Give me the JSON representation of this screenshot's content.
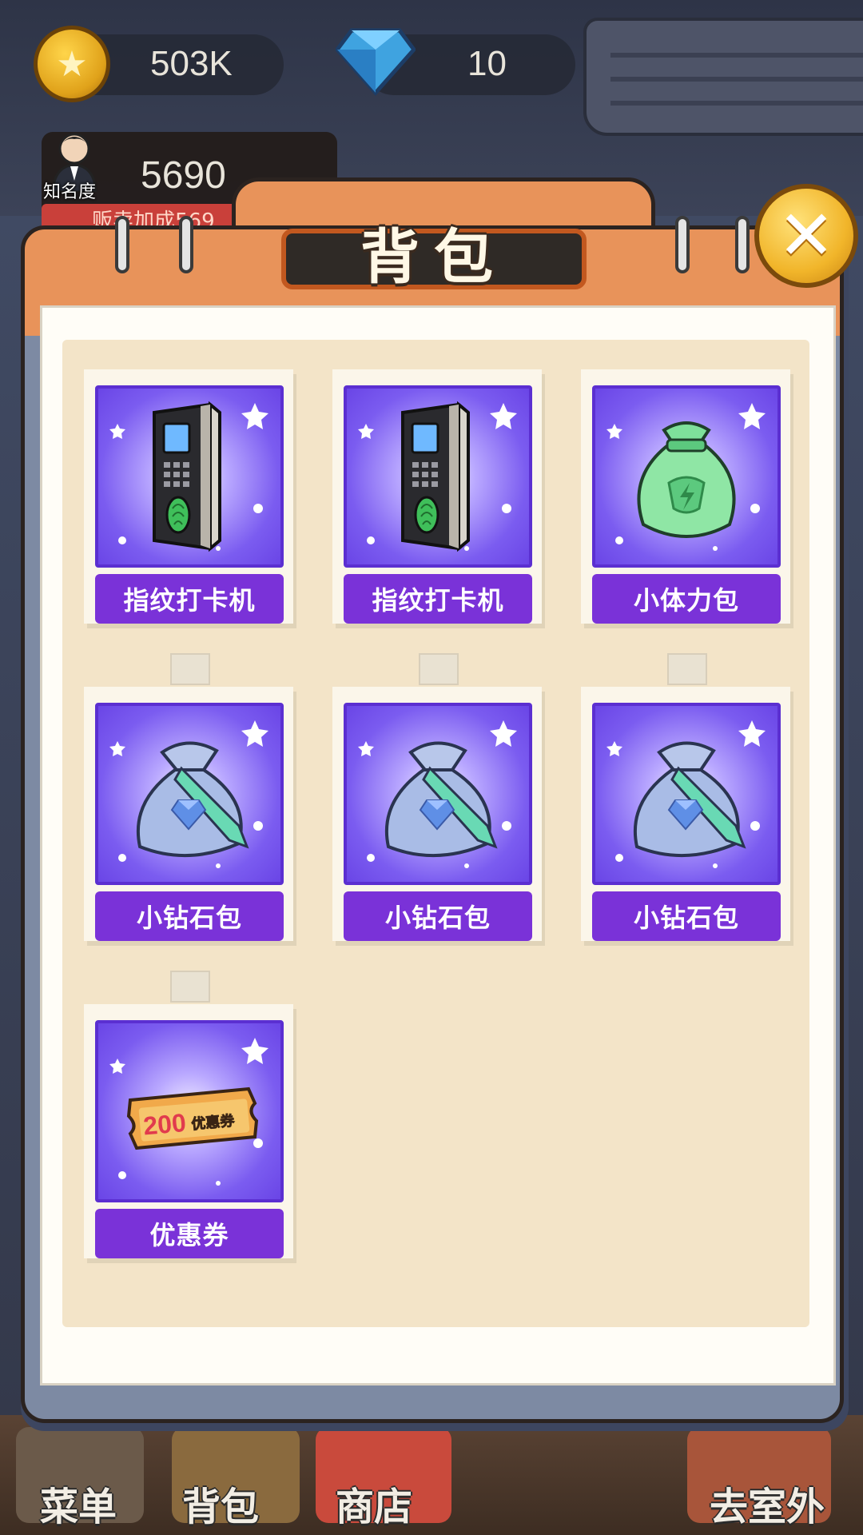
{
  "resources": {
    "coins": "503K",
    "gems": "10"
  },
  "fame": {
    "label": "知名度",
    "value": "5690",
    "bonus": "贩卖加成569"
  },
  "backpack": {
    "title": "背包",
    "items": [
      {
        "name": "指纹打卡机",
        "icon": "fingerprint-clock-icon"
      },
      {
        "name": "指纹打卡机",
        "icon": "fingerprint-clock-icon"
      },
      {
        "name": "小体力包",
        "icon": "stamina-bag-icon"
      },
      {
        "name": "小钻石包",
        "icon": "diamond-bag-icon"
      },
      {
        "name": "小钻石包",
        "icon": "diamond-bag-icon"
      },
      {
        "name": "小钻石包",
        "icon": "diamond-bag-icon"
      },
      {
        "name": "优惠券",
        "icon": "coupon-icon",
        "coupon_value": "200",
        "coupon_text": "优惠券"
      }
    ]
  },
  "nav": {
    "menu": "菜单",
    "bag": "背包",
    "shop": "商店",
    "outdoor": "去室外"
  },
  "colors": {
    "panel_orange": "#e8935a",
    "card_purple": "#7a32d8",
    "paper": "#f3e4c8"
  }
}
